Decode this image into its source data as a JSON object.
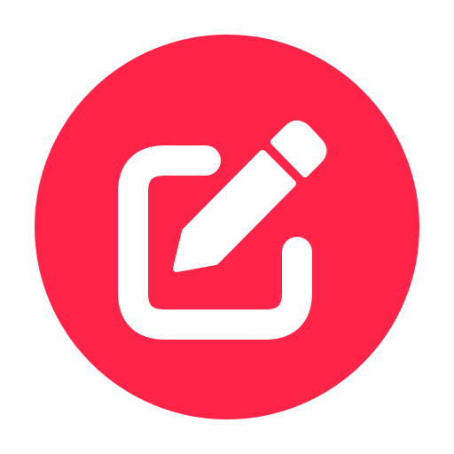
{
  "icon": {
    "name": "edit-compose-icon",
    "colors": {
      "background": "#ffffff",
      "circle": "#ff2448",
      "glyph": "#ffffff"
    }
  }
}
